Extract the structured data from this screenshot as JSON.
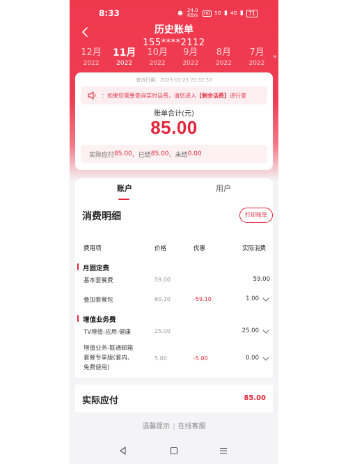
{
  "status_bar": {
    "time": "8:33",
    "network_speed": "24.0\nKB/s",
    "hd_badge": "HD",
    "signal_1": "5G",
    "signal_2": "4G",
    "battery": "71"
  },
  "header": {
    "title": "历史账单",
    "subtitle": "155****2112"
  },
  "months": [
    {
      "name": "12月",
      "year": "2022",
      "active": false
    },
    {
      "name": "11月",
      "year": "2022",
      "active": true
    },
    {
      "name": "10月",
      "year": "2022",
      "active": false
    },
    {
      "name": "9月",
      "year": "2022",
      "active": false
    },
    {
      "name": "8月",
      "year": "2022",
      "active": false
    },
    {
      "name": "7月",
      "year": "2022",
      "active": false
    }
  ],
  "month_more_arrow": "»",
  "summary": {
    "query_date": "查询日期：2023-01-23 20:32:57",
    "notice_prefix": "：如果您需要查询实时话费，请您进入",
    "notice_highlight": "【剩余话费】",
    "notice_suffix": "进行查",
    "total_label": "账单合计(元)",
    "total_amount": "85.00",
    "payable_label": "实际应付",
    "payable_value": "85.00",
    "settled_label": "、已结",
    "settled_value": "85.00",
    "unsettled_label": "、未结",
    "unsettled_value": "0.00"
  },
  "tabs": [
    {
      "label": "账户",
      "active": true
    },
    {
      "label": "用户",
      "active": false
    }
  ],
  "detail": {
    "title": "消费明细",
    "print_label": "打印账单",
    "columns": {
      "item": "费用项",
      "price": "价格",
      "discount": "优惠",
      "actual": "实际消费"
    },
    "sections": [
      {
        "name": "月固定费",
        "rows": [
          {
            "item": "基本套餐费",
            "price": "59.00",
            "discount": "",
            "actual": "59.00",
            "expandable": false
          },
          {
            "item": "叠加套餐包",
            "price": "60.10",
            "discount": "-59.10",
            "actual": "1.00",
            "expandable": true
          }
        ]
      },
      {
        "name": "增值业务费",
        "rows": [
          {
            "item": "TV增值-应用-健康",
            "price": "25.00",
            "discount": "",
            "actual": "25.00",
            "expandable": true
          },
          {
            "item_lines": [
              "增值业务-联通邮箱",
              "套餐专享版(套内、",
              "免费使用)"
            ],
            "price": "5.00",
            "discount": "-5.00",
            "actual": "0.00",
            "expandable": true
          }
        ]
      }
    ]
  },
  "payable": {
    "label": "实际应付",
    "amount": "85.00"
  },
  "footer": {
    "tips": "温馨提示",
    "separator": "|",
    "service": "在线客服"
  },
  "colors": {
    "brand_red": "#e2253a",
    "header_red": "#ee3d52",
    "notice_bg": "#fdeff1"
  }
}
